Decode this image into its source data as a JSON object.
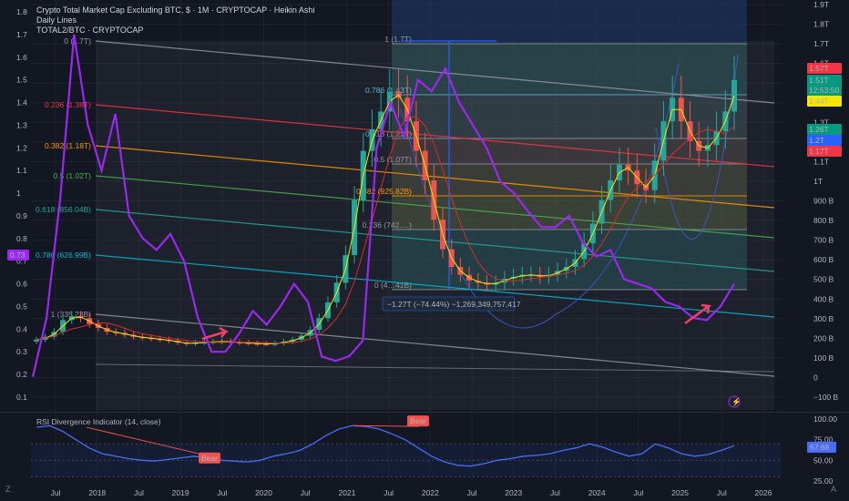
{
  "header": {
    "title": "Crypto Total Market Cap Excluding BTC, $ · 1M · CRYPTOCAP · Heikin Ashi",
    "line2": "Daily Lines",
    "line3": "TOTAL2/BTC · CRYPTOCAP"
  },
  "colors": {
    "background": "#131722",
    "grid": "#1e222d",
    "rsi_overlay": "#9c27f0",
    "candle_up": "#26a69a",
    "candle_down": "#ef5350",
    "rsi_line": "#4a6cf7",
    "arrow": "#f23f6c"
  },
  "chart_data": [
    {
      "type": "candlestick",
      "title": "Crypto Total Market Cap Excluding BTC, $ · 1M · CRYPTOCAP · Heikin Ashi",
      "x_ticks": [
        "Jul",
        "2018",
        "Jul",
        "2019",
        "Jul",
        "2020",
        "Jul",
        "2021",
        "Jul",
        "2022",
        "Jul",
        "2023",
        "Jul",
        "2024",
        "Jul",
        "2025",
        "Jul",
        "2026"
      ],
      "right_axis_ticks": [
        "1.9T",
        "1.8T",
        "1.7T",
        "1.6T",
        "1.5T",
        "1.4T",
        "1.3T",
        "1.2T",
        "1.1T",
        "1T",
        "900 B",
        "800 B",
        "700 B",
        "600 B",
        "500 B",
        "400 B",
        "300 B",
        "200 B",
        "100 B",
        "0",
        "−100 B"
      ],
      "left_axis_ticks": [
        "1.8",
        "1.7",
        "1.6",
        "1.5",
        "1.4",
        "1.3",
        "1.2",
        "1.1",
        "1",
        "0.9",
        "0.8",
        "0.7",
        "0.6",
        "0.5",
        "0.4",
        "0.3",
        "0.2",
        "0.1"
      ],
      "left_axis_marker": "0.73",
      "price_labels": [
        {
          "text": "1.57T",
          "color": "#f23645"
        },
        {
          "text": "1.51T",
          "color": "#089981"
        },
        {
          "text": "12:53:50",
          "color": "#089981"
        },
        {
          "text": "1.44T",
          "color": "#f7e600"
        },
        {
          "text": "1.26T",
          "color": "#089981"
        },
        {
          "text": "1.2T",
          "color": "#2962ff"
        },
        {
          "text": "1.17T",
          "color": "#f23645"
        }
      ],
      "fib_channel_left": [
        {
          "label": "0 (1.7T)",
          "color": "#9598a1"
        },
        {
          "label": "0.236 (1.38T)",
          "color": "#f23645"
        },
        {
          "label": "0.382 (1.18T)",
          "color": "#ff9800"
        },
        {
          "label": "0.5 (1.02T)",
          "color": "#4caf50"
        },
        {
          "label": "0.618 (856.04B)",
          "color": "#26a69a"
        },
        {
          "label": "0.786 (626.99B)",
          "color": "#00bcd4"
        },
        {
          "label": "1 (335.23B)",
          "color": "#9598a1"
        }
      ],
      "fib_retracement": [
        {
          "label": "1 (1.7T)",
          "color": "#9598a1"
        },
        {
          "label": "0.786 (1.43T)",
          "color": "#5fb3c9"
        },
        {
          "label": "0.618 (1.22T)",
          "color": "#9598a1"
        },
        {
          "label": "0.5 (1.07T)",
          "color": "#9598a1"
        },
        {
          "label": "0.382 (925.82B)",
          "color": "#ff9800"
        },
        {
          "label": "0.236 (742.…)",
          "color": "#9598a1"
        },
        {
          "label": "0 (4…41B)",
          "color": "#9598a1"
        }
      ],
      "measure_label": "−1.27T (−74.44%) −1,269,349,757,417",
      "series": [
        {
          "name": "Heikin Ashi candles (approx. close, B)",
          "values": [
            190,
            205,
            230,
            290,
            310,
            300,
            270,
            250,
            230,
            225,
            215,
            205,
            200,
            195,
            190,
            185,
            175,
            170,
            175,
            178,
            180,
            182,
            178,
            175,
            172,
            170,
            168,
            172,
            180,
            190,
            210,
            240,
            300,
            380,
            480,
            620,
            900,
            1150,
            1260,
            1350,
            1450,
            1420,
            1300,
            1150,
            1000,
            800,
            650,
            560,
            520,
            490,
            480,
            470,
            480,
            500,
            510,
            520,
            520,
            510,
            520,
            540,
            560,
            600,
            680,
            780,
            900,
            1000,
            1080,
            1050,
            980,
            950,
            1100,
            1300,
            1420,
            1300,
            1200,
            1150,
            1180,
            1250,
            1350,
            1510
          ]
        },
        {
          "name": "TOTAL2/BTC (approx.)",
          "values": [
            0.19,
            0.45,
            0.98,
            1.7,
            1.3,
            1.1,
            1.35,
            0.9,
            0.8,
            0.75,
            0.82,
            0.7,
            0.45,
            0.3,
            0.3,
            0.38,
            0.48,
            0.42,
            0.5,
            0.6,
            0.52,
            0.28,
            0.26,
            0.28,
            0.35,
            1.2,
            1.4,
            1.25,
            1.5,
            1.45,
            1.55,
            1.4,
            1.3,
            1.2,
            1.05,
            1.0,
            0.92,
            0.85,
            0.85,
            0.9,
            0.78,
            0.72,
            0.75,
            0.62,
            0.6,
            0.58,
            0.52,
            0.5,
            0.45,
            0.44,
            0.5,
            0.6
          ]
        }
      ]
    },
    {
      "type": "line",
      "title": "RSI Divergence Indicator (14, close)",
      "y_ticks": [
        "100.00",
        "75.00",
        "50.00",
        "25.00"
      ],
      "ylim": [
        25,
        100
      ],
      "current_value": "67.68",
      "divergence_labels": [
        "Bear",
        "Bear"
      ],
      "series": [
        {
          "name": "RSI (approx.)",
          "values": [
            90,
            92,
            85,
            75,
            65,
            58,
            55,
            52,
            50,
            49,
            51,
            53,
            55,
            52,
            50,
            49,
            48,
            50,
            55,
            58,
            62,
            70,
            80,
            88,
            92,
            91,
            88,
            82,
            75,
            65,
            55,
            48,
            44,
            43,
            46,
            50,
            52,
            55,
            56,
            58,
            62,
            65,
            70,
            66,
            60,
            55,
            58,
            70,
            65,
            58,
            55,
            57,
            62,
            67.68
          ]
        }
      ]
    }
  ],
  "footer": {
    "left_icon": "Z",
    "right_icon": "A"
  }
}
